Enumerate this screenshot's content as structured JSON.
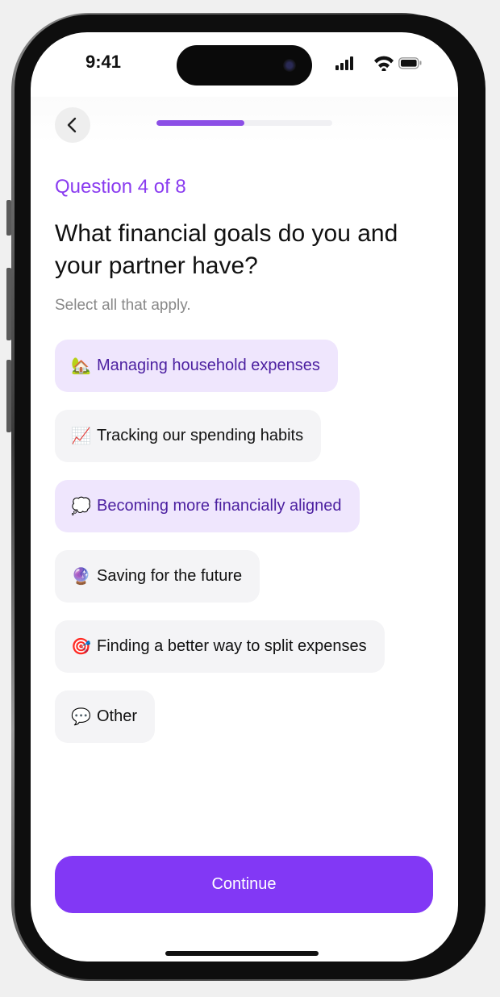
{
  "status_bar": {
    "time": "9:41",
    "icons": [
      "cellular-signal-icon",
      "wifi-icon",
      "battery-icon"
    ]
  },
  "header": {
    "back_icon": "chevron-left-icon",
    "progress_fraction": 0.5
  },
  "question": {
    "number_label": "Question 4 of 8",
    "title": "What financial goals do you and your partner have?",
    "subtitle": "Select all that apply."
  },
  "options": [
    {
      "emoji": "🏡",
      "icon": "house-garden-icon",
      "label": "Managing household expenses",
      "selected": true
    },
    {
      "emoji": "📈",
      "icon": "chart-increasing-icon",
      "label": "Tracking our spending habits",
      "selected": false
    },
    {
      "emoji": "💭",
      "icon": "thought-bubble-icon",
      "label": "Becoming more financially aligned",
      "selected": true
    },
    {
      "emoji": "🔮",
      "icon": "crystal-ball-icon",
      "label": "Saving for the future",
      "selected": false
    },
    {
      "emoji": "🎯",
      "icon": "target-icon",
      "label": "Finding a better way to split expenses",
      "selected": false
    },
    {
      "emoji": "💬",
      "icon": "speech-bubble-icon",
      "label": "Other",
      "selected": false
    }
  ],
  "continue_label": "Continue",
  "colors": {
    "accent": "#8238f5",
    "accent_text": "#8a3cf0",
    "selected_bg": "#efe6fd",
    "selected_text": "#4b1fa0",
    "option_bg": "#f4f4f6"
  }
}
